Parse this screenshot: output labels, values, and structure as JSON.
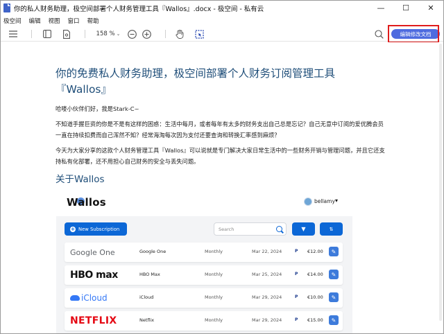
{
  "window": {
    "title": "你的私人财务助理，极空间部署个人财务管理工具『Wallos』.docx - 极空间 - 私有云",
    "controls": {
      "minimize": "—",
      "maximize": "☐",
      "close": "✕"
    }
  },
  "menu": {
    "items": [
      "极空间",
      "编辑",
      "视图",
      "窗口",
      "帮助"
    ]
  },
  "toolbar": {
    "zoom": "158 %",
    "edit_button": "编辑修改文档",
    "icons": [
      "menu-icon",
      "sidebar-icon",
      "document-icon",
      "zoom-out-icon",
      "zoom-in-icon",
      "hand-icon",
      "select-icon",
      "search-icon"
    ]
  },
  "doc": {
    "heading": "你的免费私人财务助理，极空间部署个人财务订阅管理工具『Wallos』",
    "greeting": "哈喽小伙伴们好，我是Stark-C~",
    "para1": "不知道手握巨资的你是不是有这样的困惑：生活中每月，或者每年有太多的财务支出自己总是忘记？自己无意中订阅的爱优腾会员一直在持续扣费而自己浑然不知？经常海淘每次因为支付还要查询和转换汇率感到麻烦？",
    "para2": "今天为大家分享的这款个人财务管理工具『Wallos』可以说就是专门解决大家日常生活中的一些财务开销与管理问题，并且它还支持私有化部署，还不用担心自己财务的安全与丢失问题。",
    "section": "关于Wallos"
  },
  "wallos": {
    "logo": "Wallos",
    "user": "bellamy",
    "new_subscription": "New Subscription",
    "search_placeholder": "Search",
    "subscriptions": [
      {
        "brand": "Google One",
        "name": "Google One",
        "cycle": "Monthly",
        "date": "Mar 22, 2024",
        "payment": "P",
        "price": "€12.00"
      },
      {
        "brand": "HBO max",
        "name": "HBO Max",
        "cycle": "Monthly",
        "date": "Mar 25, 2024",
        "payment": "P",
        "price": "€14.00"
      },
      {
        "brand": "iCloud",
        "name": "iCloud",
        "cycle": "Monthly",
        "date": "Mar 29, 2024",
        "payment": "P",
        "price": "€10.00"
      },
      {
        "brand": "NETFLIX",
        "name": "Netflix",
        "cycle": "Monthly",
        "date": "Mar 29, 2024",
        "payment": "P",
        "price": "€15.00"
      }
    ]
  },
  "colors": {
    "heading": "#1f4e79",
    "accent": "#4e6bdf",
    "highlight": "#e01c1c",
    "wallos_blue": "#0c67d6"
  }
}
